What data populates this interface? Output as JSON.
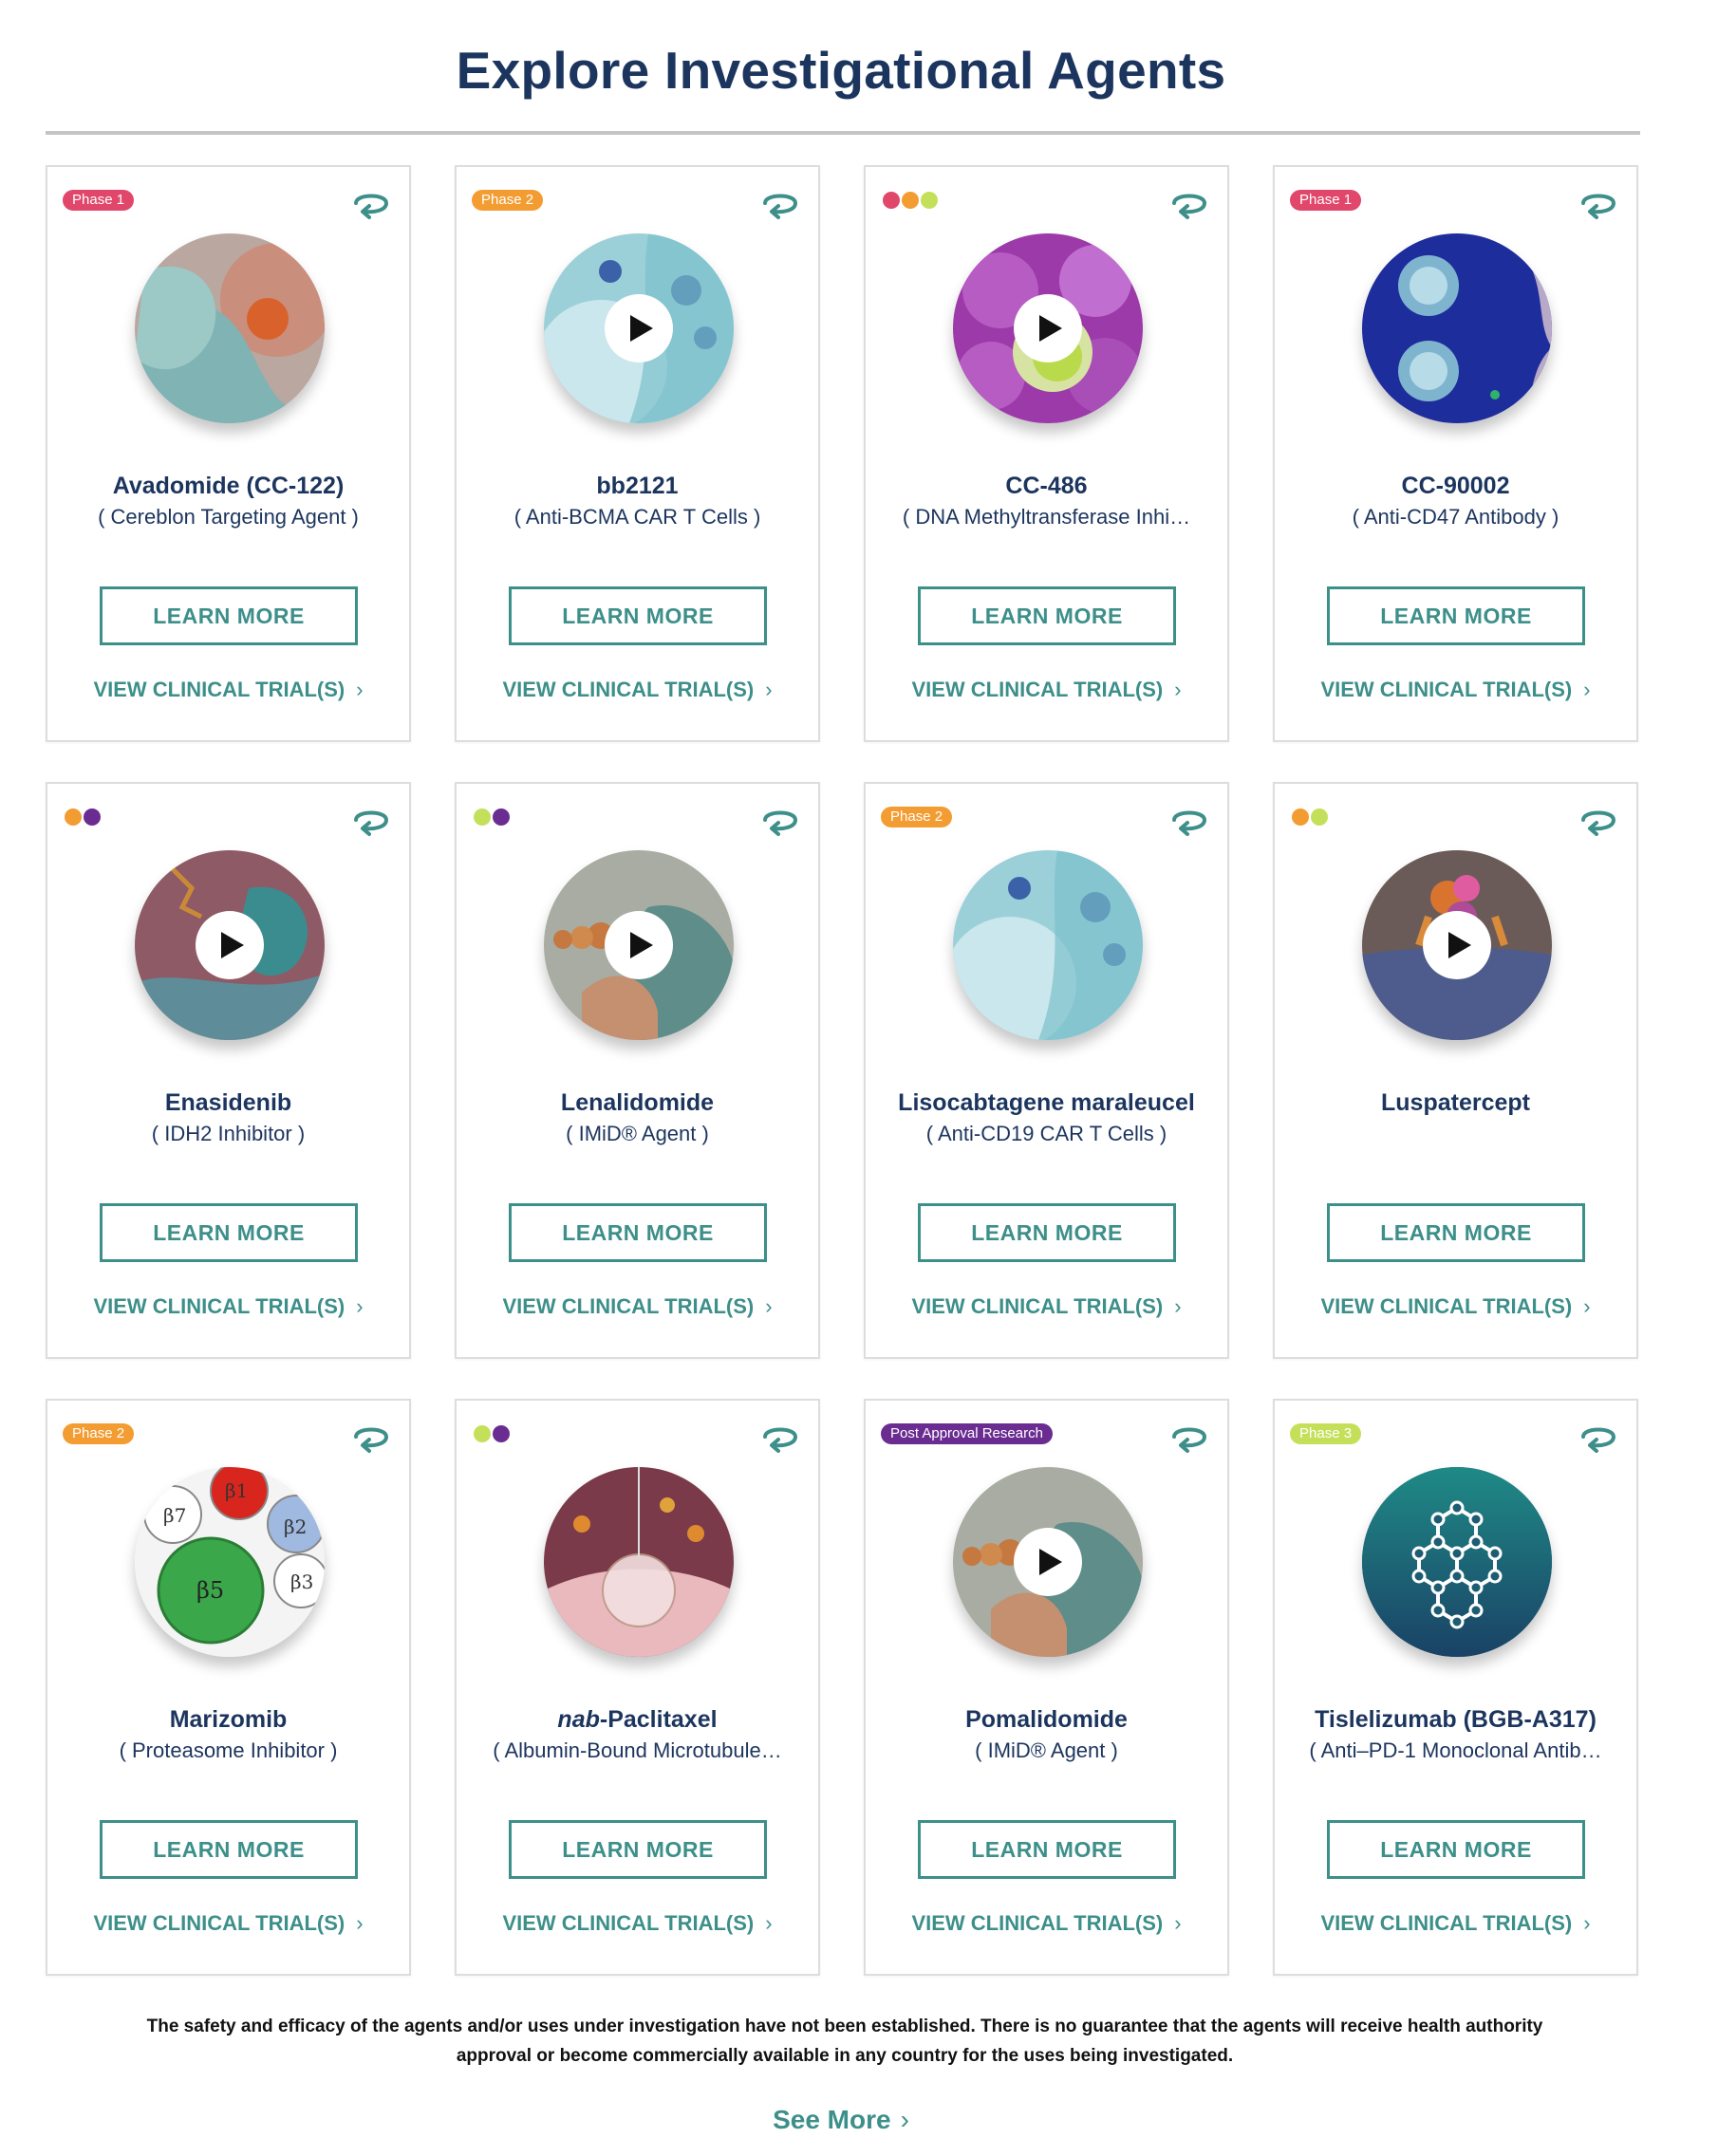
{
  "page": {
    "title": "Explore Investigational Agents"
  },
  "colors": {
    "teal": "#3d8f8a",
    "navy": "#1c355e",
    "phase1": "#e0476b",
    "phase2": "#f39c32",
    "phase3": "#c4e05a",
    "post_approval": "#6a2c91",
    "dot_red": "#e0476b",
    "dot_orange": "#f39c32",
    "dot_lime": "#c4e05a",
    "dot_purple": "#6a2c91"
  },
  "cards": [
    {
      "badge": "Phase 1",
      "badge_color": "#e0476b",
      "dots": [],
      "name": "Avadomide (CC-122)",
      "name_italic": "",
      "subtitle": "( Cereblon Targeting Agent )",
      "learn_more": "LEARN MORE",
      "trial": "VIEW CLINICAL TRIAL(S)",
      "video": false,
      "image_icon": "cell-illustration-icon"
    },
    {
      "badge": "Phase 2",
      "badge_color": "#f39c32",
      "dots": [],
      "name": "bb2121",
      "name_italic": "",
      "subtitle": "( Anti-BCMA CAR T Cells )",
      "learn_more": "LEARN MORE",
      "trial": "VIEW CLINICAL TRIAL(S)",
      "video": true,
      "image_icon": "car-t-cell-icon"
    },
    {
      "badge": "",
      "badge_color": "",
      "dots": [
        "#e0476b",
        "#f39c32",
        "#c4e05a"
      ],
      "name": "CC-486",
      "name_italic": "",
      "subtitle": "( DNA Methyltransferase Inhi…",
      "learn_more": "LEARN MORE",
      "trial": "VIEW CLINICAL TRIAL(S)",
      "video": true,
      "image_icon": "purple-cells-icon"
    },
    {
      "badge": "Phase 1",
      "badge_color": "#e0476b",
      "dots": [],
      "name": "CC-90002",
      "name_italic": "",
      "subtitle": "( Anti-CD47 Antibody )",
      "learn_more": "LEARN MORE",
      "trial": "VIEW CLINICAL TRIAL(S)",
      "video": false,
      "image_icon": "phagocytosis-diagram-icon"
    },
    {
      "badge": "",
      "badge_color": "",
      "dots": [
        "#f39c32",
        "#6a2c91"
      ],
      "name": "Enasidenib",
      "name_italic": "",
      "subtitle": "( IDH2 Inhibitor )",
      "learn_more": "LEARN MORE",
      "trial": "VIEW CLINICAL TRIAL(S)",
      "video": true,
      "image_icon": "enzyme-molecule-icon"
    },
    {
      "badge": "",
      "badge_color": "",
      "dots": [
        "#c4e05a",
        "#6a2c91"
      ],
      "name": "Lenalidomide",
      "name_italic": "",
      "subtitle": "( IMiD® Agent )",
      "learn_more": "LEARN MORE",
      "trial": "VIEW CLINICAL TRIAL(S)",
      "video": true,
      "image_icon": "protein-complex-icon"
    },
    {
      "badge": "Phase 2",
      "badge_color": "#f39c32",
      "dots": [],
      "name": "Lisocabtagene maraleucel",
      "name_italic": "",
      "subtitle": "( Anti-CD19 CAR T Cells )",
      "learn_more": "LEARN MORE",
      "trial": "VIEW CLINICAL TRIAL(S)",
      "video": false,
      "image_icon": "car-t-cell-icon"
    },
    {
      "badge": "",
      "badge_color": "",
      "dots": [
        "#f39c32",
        "#c4e05a"
      ],
      "name": "Luspatercept",
      "name_italic": "",
      "subtitle": "",
      "learn_more": "LEARN MORE",
      "trial": "VIEW CLINICAL TRIAL(S)",
      "video": true,
      "image_icon": "receptor-surface-icon"
    },
    {
      "badge": "Phase 2",
      "badge_color": "#f39c32",
      "dots": [],
      "name": "Marizomib",
      "name_italic": "",
      "subtitle": "( Proteasome Inhibitor )",
      "learn_more": "LEARN MORE",
      "trial": "VIEW CLINICAL TRIAL(S)",
      "video": false,
      "image_icon": "proteasome-subunits-icon",
      "image_labels": [
        "β1",
        "β2",
        "β3",
        "β5",
        "β7"
      ]
    },
    {
      "badge": "",
      "badge_color": "",
      "dots": [
        "#c4e05a",
        "#6a2c91"
      ],
      "name": "-Paclitaxel",
      "name_italic": "nab",
      "subtitle": "( Albumin-Bound Microtubule…",
      "learn_more": "LEARN MORE",
      "trial": "VIEW CLINICAL TRIAL(S)",
      "video": false,
      "image_icon": "tumor-vessel-icon"
    },
    {
      "badge": "Post Approval Research",
      "badge_color": "#6a2c91",
      "dots": [],
      "name": "Pomalidomide",
      "name_italic": "",
      "subtitle": "( IMiD® Agent )",
      "learn_more": "LEARN MORE",
      "trial": "VIEW CLINICAL TRIAL(S)",
      "video": true,
      "image_icon": "protein-complex-icon"
    },
    {
      "badge": "Phase 3",
      "badge_color": "#c4e05a",
      "dots": [],
      "name": "Tislelizumab (BGB-A317)",
      "name_italic": "",
      "subtitle": "( Anti–PD-1 Monoclonal Antib…",
      "learn_more": "LEARN MORE",
      "trial": "VIEW CLINICAL TRIAL(S)",
      "video": false,
      "image_icon": "molecule-hexagon-icon"
    }
  ],
  "disclaimer": "The safety and efficacy of the agents and/or uses under investigation have not been established. There is no guarantee that the agents will receive health authority approval or become commercially available in any country for the uses being investigated.",
  "see_more": "See More"
}
